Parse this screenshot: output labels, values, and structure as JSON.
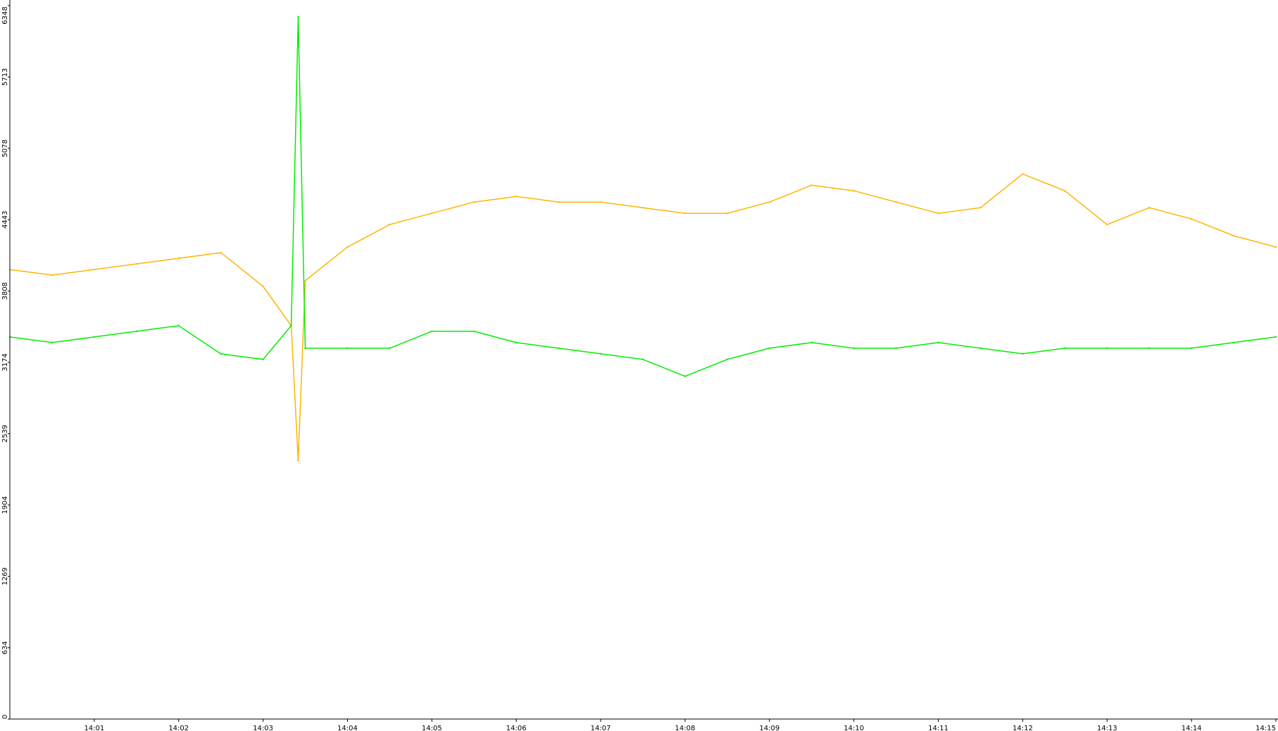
{
  "chart_data": {
    "type": "line",
    "title": "",
    "xlabel": "",
    "ylabel": "",
    "x_ticks": [
      "14:01",
      "14:02",
      "14:03",
      "14:04",
      "14:05",
      "14:06",
      "14:07",
      "14:08",
      "14:09",
      "14:10",
      "14:11",
      "14:12",
      "14:13",
      "14:14",
      "14:15"
    ],
    "y_ticks": [
      "0",
      "634",
      "1269",
      "1904",
      "2539",
      "3174",
      "3808",
      "4443",
      "5078",
      "5713",
      "6348"
    ],
    "xlim": [
      "14:00",
      "14:15"
    ],
    "ylim": [
      0,
      6348
    ],
    "grid": false,
    "background": "#ffffff",
    "series": [
      {
        "color": "#ffb400",
        "x": [
          "14:00",
          "14:00:30",
          "14:01",
          "14:01:30",
          "14:02",
          "14:02:30",
          "14:03",
          "14:03:20",
          "14:03:25",
          "14:03:30",
          "14:04",
          "14:04:30",
          "14:05",
          "14:05:30",
          "14:06",
          "14:06:30",
          "14:07",
          "14:07:30",
          "14:08",
          "14:08:30",
          "14:09",
          "14:09:30",
          "14:10",
          "14:10:30",
          "14:11",
          "14:11:30",
          "14:12",
          "14:12:30",
          "14:13",
          "14:13:30",
          "14:14",
          "14:14:30",
          "14:15"
        ],
        "values": [
          4000,
          3950,
          4000,
          4050,
          4100,
          4150,
          3850,
          3500,
          2300,
          3900,
          4200,
          4400,
          4500,
          4600,
          4650,
          4600,
          4600,
          4550,
          4500,
          4500,
          4600,
          4750,
          4700,
          4600,
          4500,
          4550,
          4850,
          4700,
          4400,
          4550,
          4450,
          4300,
          4200
        ]
      },
      {
        "color": "#00ee00",
        "x": [
          "14:00",
          "14:00:30",
          "14:01",
          "14:01:30",
          "14:02",
          "14:02:30",
          "14:03",
          "14:03:20",
          "14:03:25",
          "14:03:30",
          "14:04",
          "14:04:30",
          "14:05",
          "14:05:30",
          "14:06",
          "14:06:30",
          "14:07",
          "14:07:30",
          "14:08",
          "14:08:30",
          "14:09",
          "14:09:30",
          "14:10",
          "14:10:30",
          "14:11",
          "14:11:30",
          "14:12",
          "14:12:30",
          "14:13",
          "14:13:30",
          "14:14",
          "14:14:30",
          "14:15"
        ],
        "values": [
          3400,
          3350,
          3400,
          3450,
          3500,
          3250,
          3200,
          3500,
          6250,
          3300,
          3300,
          3300,
          3450,
          3450,
          3350,
          3300,
          3250,
          3200,
          3050,
          3200,
          3300,
          3350,
          3300,
          3300,
          3350,
          3300,
          3250,
          3300,
          3300,
          3300,
          3300,
          3350,
          3400
        ]
      }
    ]
  }
}
